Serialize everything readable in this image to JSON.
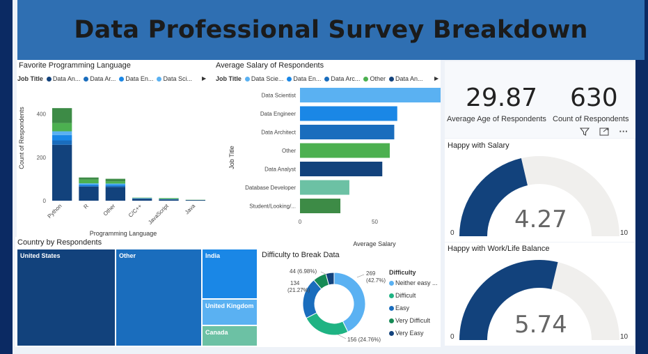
{
  "title": "Data Professional Survey Breakdown",
  "colors": {
    "banner": "#2f6fb2",
    "navy": "#12427c",
    "blue": "#1a87e6",
    "light_blue": "#5ab1f2",
    "green": "#4cb050",
    "teal": "#6cc1a4",
    "dark_green": "#3d8b46",
    "gauge_bg": "#f0efed"
  },
  "lang_chart": {
    "title": "Favorite Programming Language",
    "legend_label": "Job Title",
    "legend": [
      {
        "name": "Data An...",
        "color": "#12427c"
      },
      {
        "name": "Data Ar...",
        "color": "#1a6dbd"
      },
      {
        "name": "Data En...",
        "color": "#1a87e6"
      },
      {
        "name": "Data Sci...",
        "color": "#5ab1f2"
      }
    ],
    "legend_more": "▶",
    "xlabel": "Programming Language",
    "ylabel": "Count of Respondents"
  },
  "salary_chart": {
    "title": "Average Salary of Respondents",
    "legend_label": "Job Title",
    "legend": [
      {
        "name": "Data Scie...",
        "color": "#5ab1f2"
      },
      {
        "name": "Data En...",
        "color": "#1a87e6"
      },
      {
        "name": "Data Arc...",
        "color": "#1a6dbd"
      },
      {
        "name": "Other",
        "color": "#4cb050"
      },
      {
        "name": "Data An...",
        "color": "#12427c"
      }
    ],
    "legend_more": "▶",
    "xlabel": "Average Salary",
    "ylabel": "Job Title"
  },
  "kpi": {
    "age_value": "29.87",
    "age_label": "Average Age of Respondents",
    "count_value": "630",
    "count_label": "Count of Respondents"
  },
  "gauge_salary": {
    "title": "Happy with Salary",
    "value_text": "4.27",
    "value": 4.27,
    "min": "0",
    "max": "10"
  },
  "gauge_work": {
    "title": "Happy with Work/Life Balance",
    "value_text": "5.74",
    "value": 5.74,
    "min": "0",
    "max": "10"
  },
  "country": {
    "title": "Country by Respondents",
    "items": [
      {
        "name": "United States",
        "color": "#12427c"
      },
      {
        "name": "Other",
        "color": "#1a6dbd"
      },
      {
        "name": "India",
        "color": "#1a87e6"
      },
      {
        "name": "United Kingdom",
        "color": "#5ab1f2"
      },
      {
        "name": "Canada",
        "color": "#6cc1a4"
      }
    ]
  },
  "difficulty": {
    "title": "Difficulty to Break Data",
    "legend_title": "Difficulty",
    "legend": [
      {
        "name": "Neither easy ...",
        "color": "#5ab1f2"
      },
      {
        "name": "Difficult",
        "color": "#1fb383"
      },
      {
        "name": "Easy",
        "color": "#1a6dbd"
      },
      {
        "name": "Very Difficult",
        "color": "#168a55"
      },
      {
        "name": "Very Easy",
        "color": "#12427c"
      }
    ],
    "labels": {
      "neither": [
        "269",
        "(42.7%)"
      ],
      "difficult": "156 (24.76%)",
      "easy": [
        "134",
        "(21.27%)"
      ],
      "very_difficult": "44 (6.98%)"
    }
  },
  "chart_data": [
    {
      "type": "bar",
      "title": "Favorite Programming Language",
      "xlabel": "Programming Language",
      "ylabel": "Count of Respondents",
      "categories": [
        "Python",
        "R",
        "Other",
        "C/C++",
        "JavaScript",
        "Java"
      ],
      "yticks": [
        "0",
        "200",
        "400"
      ],
      "ylim": [
        0,
        450
      ],
      "stacked": true,
      "series": [
        {
          "name": "Data Analyst",
          "values": [
            258,
            65,
            63,
            9,
            6,
            3
          ]
        },
        {
          "name": "Data Architect",
          "values": [
            20,
            4,
            5,
            1,
            0,
            0
          ]
        },
        {
          "name": "Data Engineer",
          "values": [
            25,
            5,
            6,
            1,
            1,
            0
          ]
        },
        {
          "name": "Data Scientist",
          "values": [
            17,
            6,
            5,
            1,
            1,
            0
          ]
        },
        {
          "name": "Other",
          "values": [
            38,
            17,
            10,
            2,
            4,
            1
          ]
        },
        {
          "name": "Student",
          "values": [
            69,
            10,
            12,
            0,
            0,
            0
          ]
        }
      ]
    },
    {
      "type": "bar",
      "orientation": "horizontal",
      "title": "Average Salary of Respondents",
      "xlabel": "Average Salary",
      "ylabel": "Job Title",
      "categories": [
        "Data Scientist",
        "Data Engineer",
        "Data Architect",
        "Other",
        "Data Analyst",
        "Database Developer",
        "Student/Looking/..."
      ],
      "values": [
        94,
        65,
        63,
        60,
        55,
        33,
        27
      ],
      "colors": [
        "#5ab1f2",
        "#1a87e6",
        "#1a6dbd",
        "#4cb050",
        "#12427c",
        "#6cc1a4",
        "#3d8b46"
      ],
      "xticks": [
        "0",
        "50",
        "100"
      ],
      "xlim": [
        0,
        100
      ]
    },
    {
      "type": "pie",
      "title": "Difficulty to Break Data",
      "labels": [
        "Neither easy ...",
        "Difficult",
        "Easy",
        "Very Difficult",
        "Very Easy"
      ],
      "values": [
        269,
        156,
        134,
        44,
        27
      ],
      "percent": [
        42.7,
        24.76,
        21.27,
        6.98,
        4.29
      ]
    },
    {
      "type": "table",
      "title": "Country by Respondents",
      "categories": [
        "United States",
        "Other",
        "India",
        "United Kingdom",
        "Canada"
      ],
      "values": [
        262,
        242,
        74,
        38,
        30
      ]
    }
  ]
}
